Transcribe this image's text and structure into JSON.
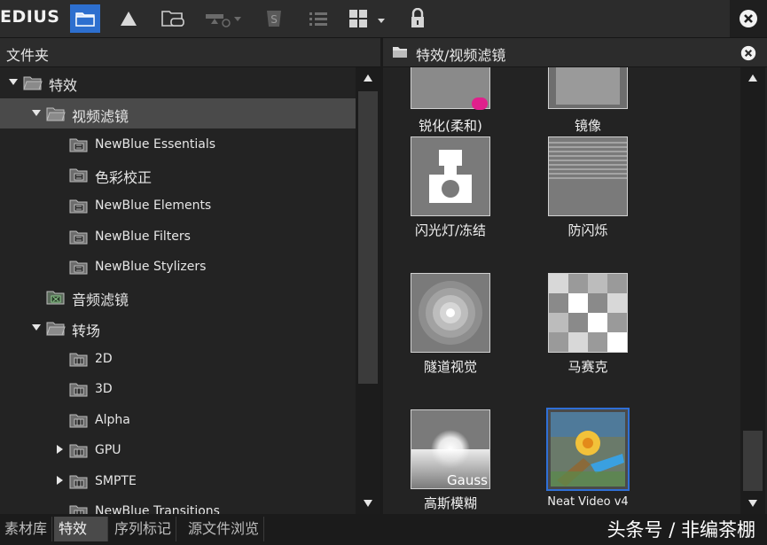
{
  "toolbar": {
    "brand": "EDIUS",
    "buttons": [
      {
        "icon": "folder-icon",
        "active": true
      },
      {
        "icon": "effects-triangle-icon"
      },
      {
        "icon": "folder-link-icon"
      },
      {
        "icon": "add-effect-dropdown-icon"
      },
      {
        "icon": "s-badge-icon"
      },
      {
        "icon": "list-view-icon"
      },
      {
        "icon": "grid-view-dropdown-icon"
      },
      {
        "icon": "lock-icon"
      }
    ],
    "close_icon": "close-icon"
  },
  "left_panel": {
    "title": "文件夹",
    "tree": [
      {
        "label": "特效",
        "expanded": true
      },
      {
        "label": "视频滤镜",
        "expanded": true
      },
      {
        "label": "NewBlue Essentials"
      },
      {
        "label": "色彩校正"
      },
      {
        "label": "NewBlue Elements"
      },
      {
        "label": "NewBlue Filters"
      },
      {
        "label": "NewBlue Stylizers"
      },
      {
        "label": "音频滤镜"
      },
      {
        "label": "转场",
        "expanded": true
      },
      {
        "label": "2D"
      },
      {
        "label": "3D"
      },
      {
        "label": "Alpha"
      },
      {
        "label": "GPU",
        "collapsed": true
      },
      {
        "label": "SMPTE",
        "collapsed": true
      },
      {
        "label": "NewBlue Transitions"
      }
    ]
  },
  "right_panel": {
    "title": "特效/视频滤镜",
    "tiles": [
      {
        "label": "锐化(柔和)"
      },
      {
        "label": "镜像"
      },
      {
        "label": "闪光灯/冻结"
      },
      {
        "label": "防闪烁"
      },
      {
        "label": "隧道视觉"
      },
      {
        "label": "马赛克"
      },
      {
        "label": "高斯模糊",
        "thumb_text": "Gauss"
      },
      {
        "label": "Neat Video v4",
        "selected": true
      }
    ]
  },
  "bottom_tabs": [
    {
      "label": "素材库"
    },
    {
      "label": "特效",
      "active": true
    },
    {
      "label": "序列标记"
    },
    {
      "label": "源文件浏览"
    }
  ],
  "watermark": "头条号 / 非编茶棚",
  "colors": {
    "accent": "#2d6fcf",
    "selected_row": "#4a4a4a",
    "background": "#232323"
  }
}
